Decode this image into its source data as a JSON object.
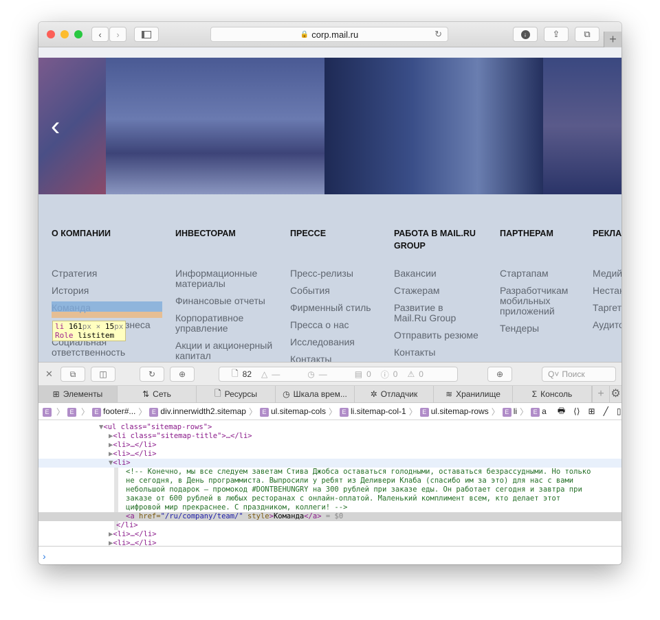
{
  "browser": {
    "url": "corp.mail.ru"
  },
  "sitemap": {
    "columns": [
      {
        "title": "О КОМПАНИИ",
        "items": [
          "Стратегия",
          "История",
          "Команда",
          "Направления бизнеса",
          "Социальная ответственность"
        ]
      },
      {
        "title": "ИНВЕСТОРАМ",
        "items": [
          "Информационные материалы",
          "Финансовые отчеты",
          "Корпоративное управление",
          "Акции и акционерный капитал"
        ]
      },
      {
        "title": "ПРЕССЕ",
        "items": [
          "Пресс-релизы",
          "События",
          "Фирменный стиль",
          "Пресса о нас",
          "Исследования",
          "Контакты"
        ]
      },
      {
        "title": "РАБОТА В MAIL.RU GROUP",
        "items": [
          "Вакансии",
          "Стажерам",
          "Развитие в Mail.Ru Group",
          "Отправить резюме",
          "Контакты"
        ]
      },
      {
        "title": "ПАРТНЕРАМ",
        "items": [
          "Стартапам",
          "Разработчикам мобильных приложений",
          "Тендеры"
        ]
      },
      {
        "title": "РЕКЛА",
        "items": [
          "Медий",
          "Нестан",
          "Таргет",
          "Аудито"
        ]
      }
    ],
    "tooltip": {
      "tag": "li",
      "w": "161",
      "h": "15",
      "unit": "px",
      "x": "×",
      "role_label": "Role",
      "role": "listitem"
    }
  },
  "devtools": {
    "resources_count": "82",
    "dash1": "—",
    "dash2": "—",
    "messages": "0",
    "errors": "0",
    "warnings": "0",
    "search_placeholder": "Поиск",
    "tabs": [
      "Элементы",
      "Сеть",
      "Ресурсы",
      "Шкала врем...",
      "Отладчик",
      "Хранилище",
      "Консоль"
    ],
    "breadcrumbs": [
      "",
      "",
      "footer#...",
      "div.innerwidth2.sitemap",
      "ul.sitemap-cols",
      "li.sitemap-col-1",
      "ul.sitemap-rows",
      "li",
      "a"
    ],
    "dom": {
      "ul_open": "<ul class=\"sitemap-rows\">",
      "li_title": "<li class=\"sitemap-title\">…</li>",
      "li_collapsed": "<li>…</li>",
      "li_open": "<li>",
      "comment": [
        "<!-- Конечно, мы все следуем заветам Стива Джобса оставаться голодными, оставаться безрассудными. Но только",
        "не сегодня, в День программиста. Выпросили у ребят из Деливери Клаба (спасибо им за это) для нас с вами",
        "небольшой подарок — промокод #DONTBEHUNGRY на 300 рублей при заказе еды. Он работает сегодня и завтра при",
        "заказе от 600 рублей в любых ресторанах с онлайн-оплатой. Маленький комплимент всем, кто делает этот",
        "цифровой мир прекраснее. С праздником, коллеги! -->"
      ],
      "a_href": "/ru/company/team/",
      "a_text": "Команда",
      "a_suffix": "= $0",
      "li_close": "</li>"
    }
  }
}
